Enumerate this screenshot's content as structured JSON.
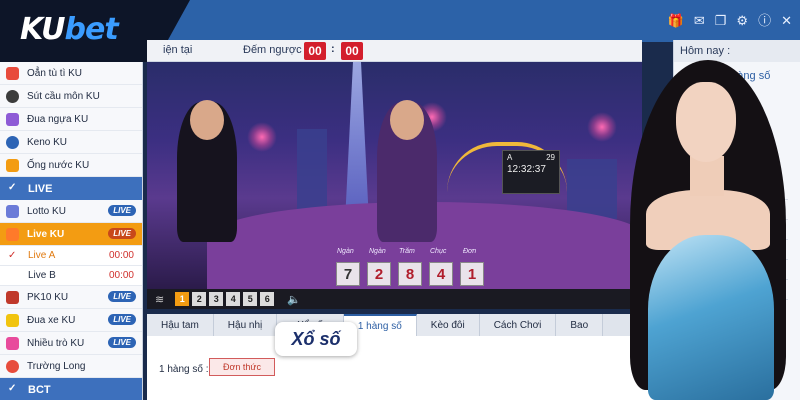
{
  "brand": {
    "logo_ku": "KU",
    "logo_bet": "bet"
  },
  "header": {
    "icons": [
      "gift-icon",
      "mail-icon",
      "copy-icon",
      "gear-icon",
      "info-icon",
      "close-icon"
    ],
    "icon_glyphs": [
      "🎁",
      "✉",
      "❐",
      "⚙",
      "ⓘ",
      "✕"
    ]
  },
  "subbar": {
    "period_label": "iện tại",
    "countdown_label": "Đếm ngược :",
    "minutes": "00",
    "seconds": "00",
    "separator": ":"
  },
  "right_panel": {
    "header": "Hôm nay :",
    "item": "1 hàng số"
  },
  "sidebar": {
    "items_top": [
      {
        "label": "Oẳn tù tì KU",
        "icon_color": "#e84b3c"
      },
      {
        "label": "Sút cầu môn KU",
        "icon_color": "#3c3c3c"
      },
      {
        "label": "Đua ngựa KU",
        "icon_color": "#8e5bd6"
      },
      {
        "label": "Keno KU",
        "icon_color": "#2d64b5"
      },
      {
        "label": "Ống nước KU",
        "icon_color": "#f39c12"
      }
    ],
    "live_header": "LIVE",
    "live_items": [
      {
        "label": "Lotto KU",
        "badge": "LIVE",
        "icon_color": "#6b7bd8"
      },
      {
        "label": "Live KU",
        "badge": "LIVE",
        "icon_color": "#ff7a2a"
      }
    ],
    "sub_items": [
      {
        "label": "Live A",
        "time": "00:00"
      },
      {
        "label": "Live B",
        "time": "00:00"
      }
    ],
    "items_bottom": [
      {
        "label": "PK10 KU",
        "badge": "LIVE",
        "icon_color": "#c0392b"
      },
      {
        "label": "Đua xe KU",
        "badge": "LIVE",
        "icon_color": "#f1c40f"
      },
      {
        "label": "Nhiều trò KU",
        "badge": "LIVE",
        "icon_color": "#e84b9c"
      },
      {
        "label": "Trường Long",
        "icon_color": "#e74c3c"
      }
    ],
    "bct_header": "BCT"
  },
  "video": {
    "table_labels": [
      "Ngàn",
      "Ngàn",
      "Trăm",
      "Chục",
      "Đơn"
    ],
    "digits": [
      "7",
      "2",
      "8",
      "4",
      "1"
    ],
    "timer": {
      "round": "A",
      "count": "29",
      "clock": "12:32:37"
    },
    "camera_buttons": [
      "1",
      "2",
      "3",
      "4",
      "5",
      "6"
    ],
    "active_camera": "1"
  },
  "tabs": [
    "Hậu tam",
    "Hậu nhị",
    "Xổ số",
    "1 hàng số",
    "Kèo đôi",
    "Cách Chơi",
    "Bao"
  ],
  "active_tab": "1 hàng số",
  "bet_area": {
    "label": "1 hàng số :",
    "button": "Đơn thức"
  },
  "overlay_label": "Xổ số"
}
